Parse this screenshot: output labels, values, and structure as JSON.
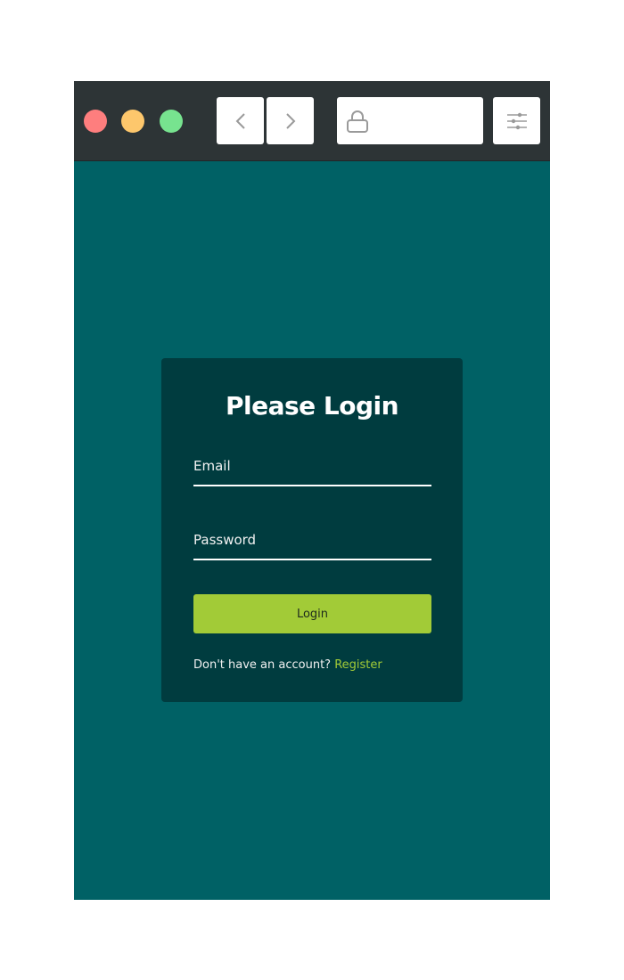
{
  "toolbar": {
    "dots": [
      "#fe7e7e",
      "#fdc76c",
      "#77e38f"
    ],
    "back_icon": "chevron-left-icon",
    "forward_icon": "chevron-right-icon",
    "lock_icon": "lock-icon",
    "settings_icon": "sliders-icon"
  },
  "login": {
    "title": "Please Login",
    "email_label": "Email",
    "password_label": "Password",
    "button_label": "Login",
    "register_prompt": "Don't have an account?",
    "register_link": "Register"
  },
  "colors": {
    "page_bg": "#006165",
    "card_bg": "#003c3f",
    "accent": "#a2cb37",
    "toolbar_bg": "#2d3436"
  }
}
